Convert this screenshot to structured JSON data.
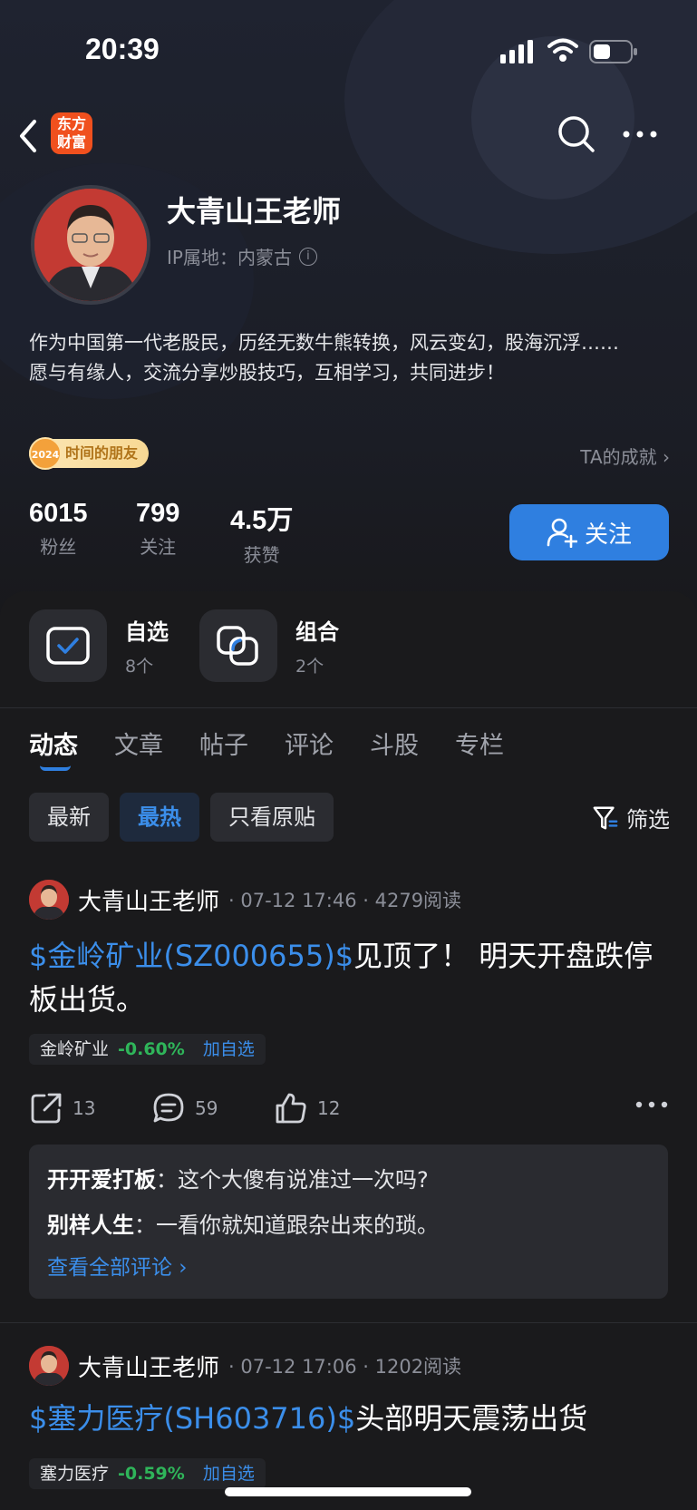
{
  "status_bar": {
    "time": "20:39"
  },
  "nav": {
    "logo_line1": "东方",
    "logo_line2": "财富"
  },
  "profile": {
    "name": "大青山王老师",
    "ip_location": "IP属地：内蒙古",
    "bio_line1": "作为中国第一代老股民，历经无数牛熊转换，风云变幻，股海沉浮……",
    "bio_line2": "愿与有缘人，交流分享炒股技巧，互相学习，共同进步！",
    "badge_year": "2024",
    "badge_label": "时间的朋友",
    "achievement_link": "TA的成就 ›",
    "stats": [
      {
        "value": "6015",
        "label": "粉丝"
      },
      {
        "value": "799",
        "label": "关注"
      },
      {
        "value": "4.5万",
        "label": "获赞"
      }
    ],
    "follow_label": "关注"
  },
  "quick": [
    {
      "title": "自选",
      "sub": "8个"
    },
    {
      "title": "组合",
      "sub": "2个"
    }
  ],
  "tabs": [
    "动态",
    "文章",
    "帖子",
    "评论",
    "斗股",
    "专栏"
  ],
  "filters": {
    "chips": [
      "最新",
      "最热",
      "只看原贴"
    ],
    "active": "最热",
    "filter_label": "筛选"
  },
  "posts": [
    {
      "author": "大青山王老师",
      "meta": "· 07-12 17:46 · 4279阅读",
      "stock": "$金岭矿业(SZ000655)$",
      "text": "见顶了！ 明天开盘跌停板出货。",
      "tag_name": "金岭矿业",
      "tag_change": "-0.60%",
      "tag_add": "加自选",
      "shares": "13",
      "comments_count": "59",
      "likes": "12",
      "comments": [
        {
          "user": "开开爱打板",
          "text": "这个大傻有说准过一次吗?"
        },
        {
          "user": "别样人生",
          "text": "一看你就知道跟杂出来的琐。"
        }
      ],
      "view_all": "查看全部评论 ›"
    },
    {
      "author": "大青山王老师",
      "meta": "· 07-12 17:06 · 1202阅读",
      "stock": "$塞力医疗(SH603716)$",
      "text": "头部明天震荡出货",
      "tag_name": "塞力医疗",
      "tag_change": "-0.59%",
      "tag_add": "加自选"
    }
  ],
  "colors": {
    "accent": "#2f7fe0",
    "link": "#3b8eea",
    "down_green": "#2fb55a",
    "background": "#1a1a1c"
  }
}
